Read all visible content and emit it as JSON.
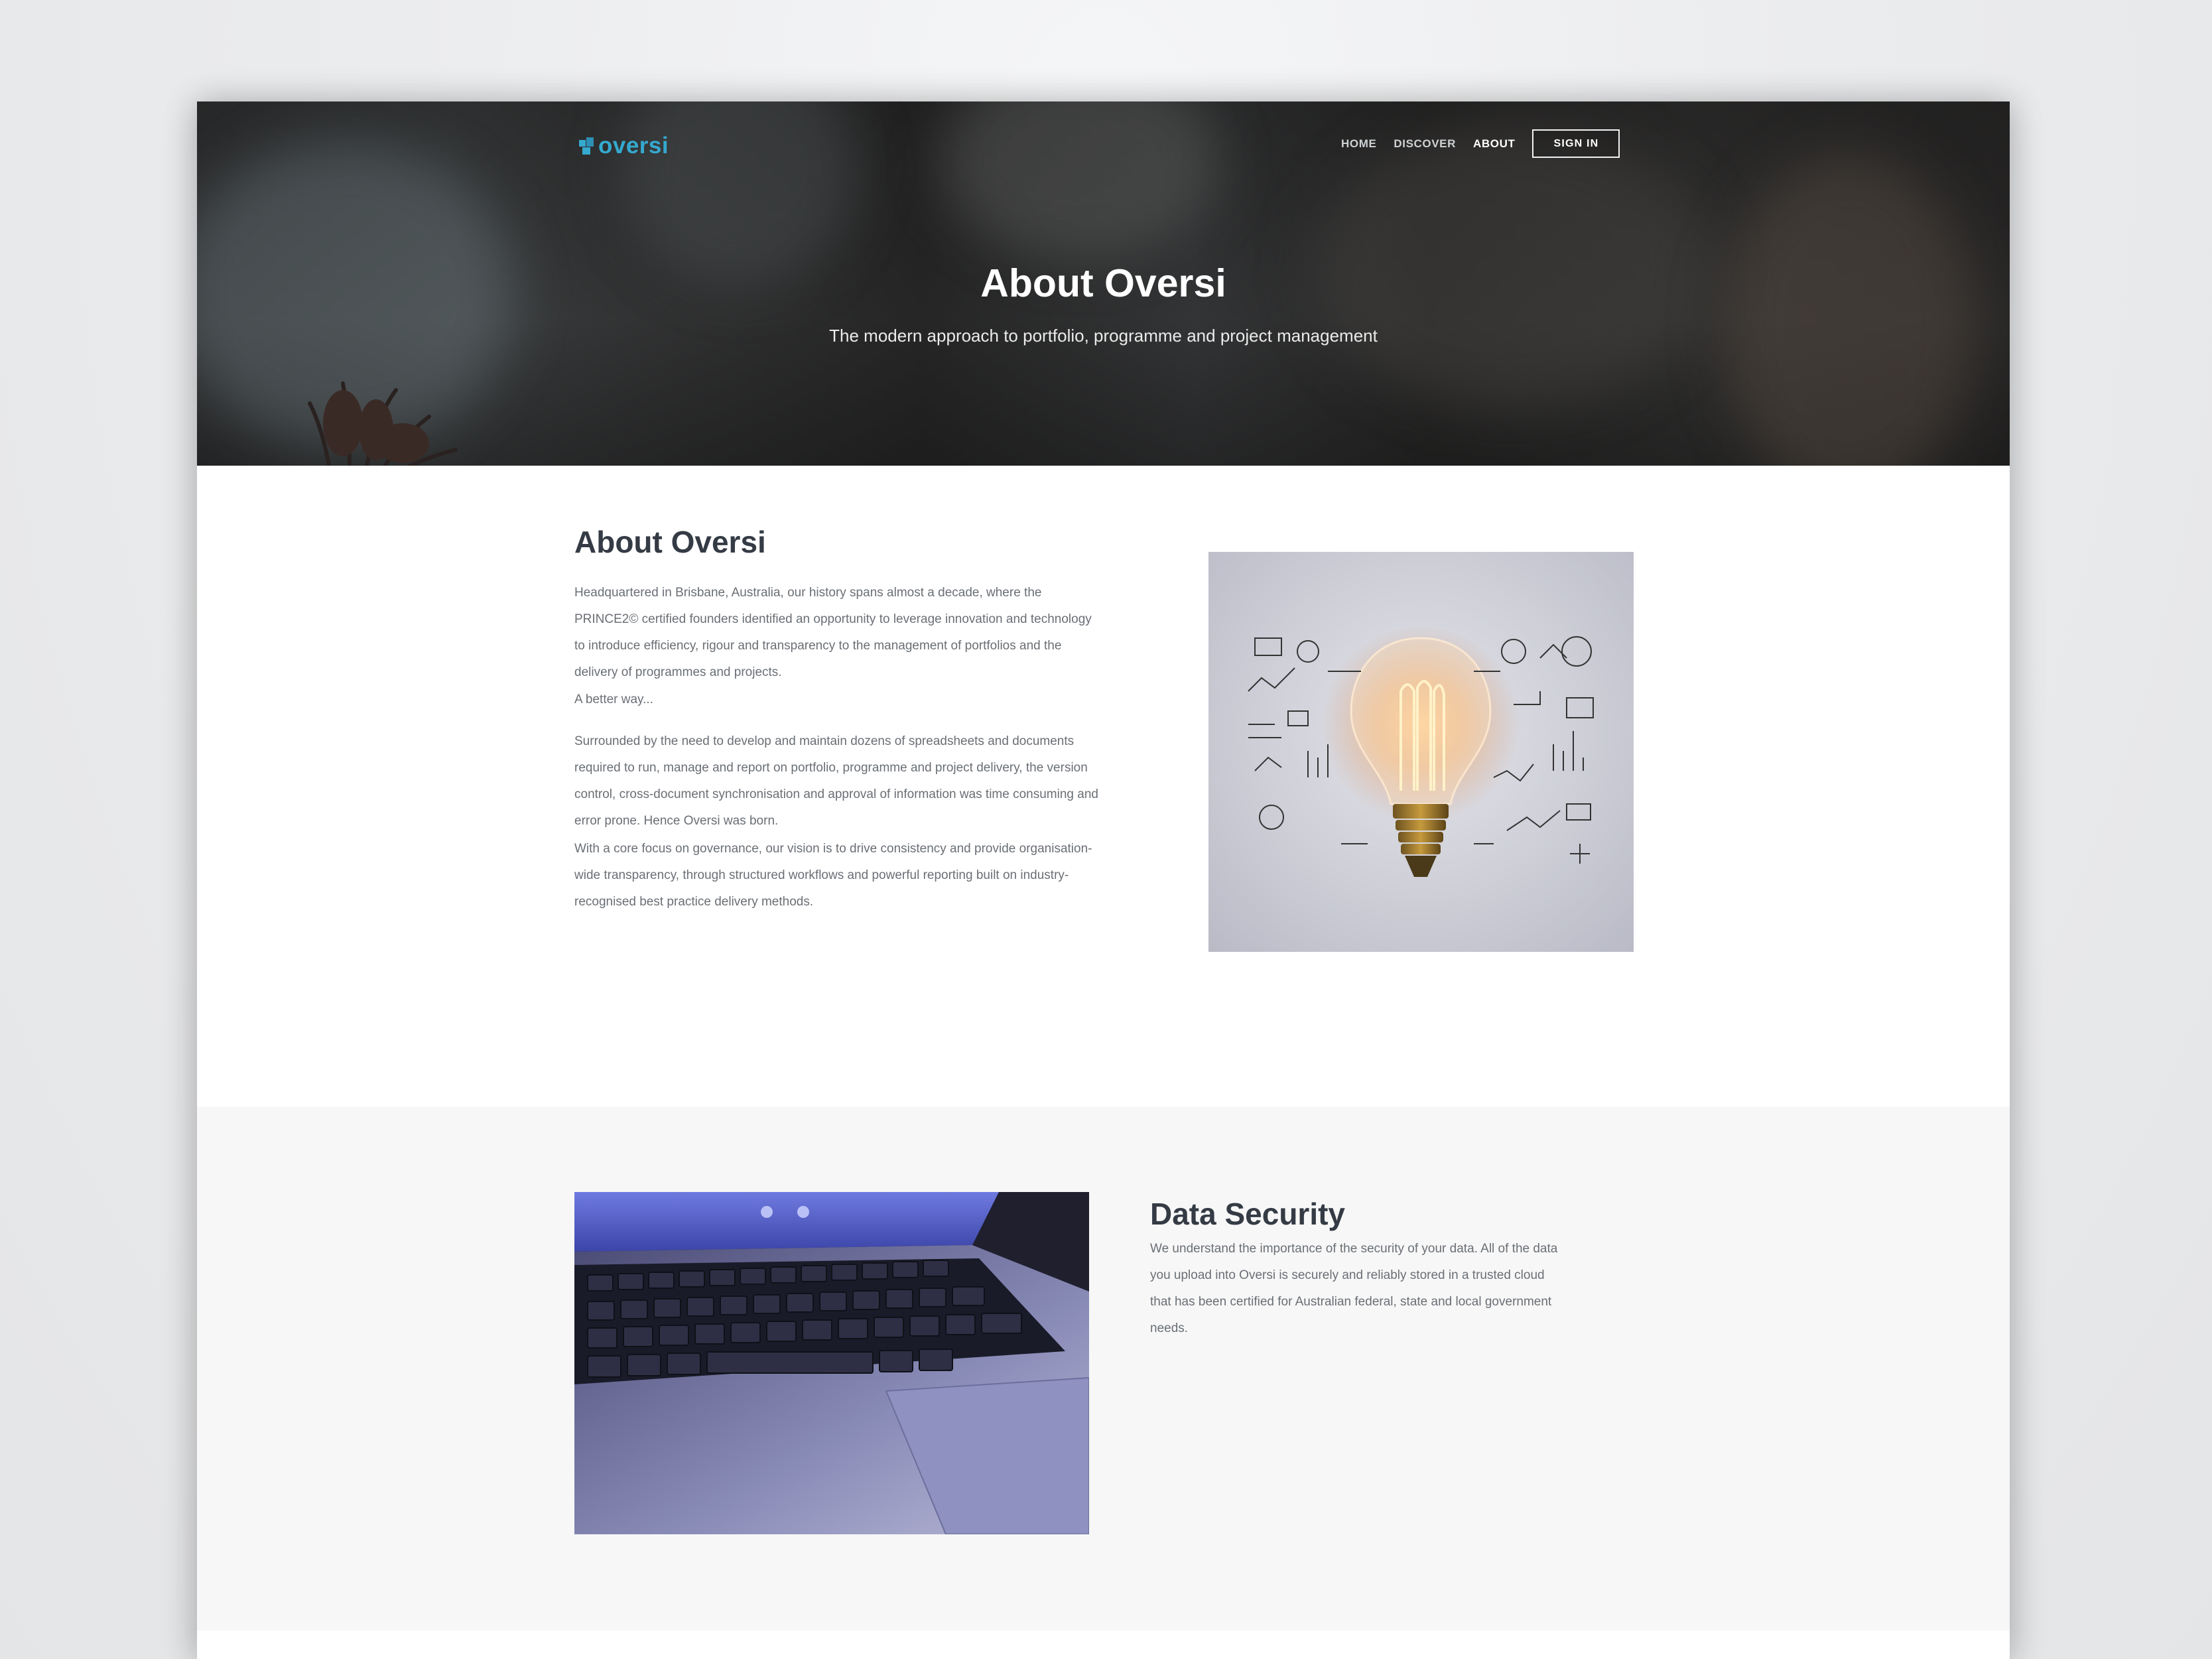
{
  "brand": {
    "name": "oversi",
    "accent_color": "#35a9cf"
  },
  "nav": {
    "items": [
      {
        "label": "HOME"
      },
      {
        "label": "DISCOVER"
      },
      {
        "label": "ABOUT",
        "active": true
      }
    ],
    "sign_in_label": "SIGN IN"
  },
  "hero": {
    "title": "About Oversi",
    "subtitle": "The modern approach to portfolio, programme and project management"
  },
  "about": {
    "heading": "About Oversi",
    "paragraphs": [
      "Headquartered in Brisbane, Australia, our history spans almost a decade, where the PRINCE2© certified founders identified an opportunity to leverage innovation and technology to introduce efficiency, rigour and transparency to the management of portfolios and the delivery of programmes and projects.",
      "A better way...",
      "Surrounded by the need to develop and maintain dozens of spreadsheets and documents required to run, manage and report on portfolio, programme and project delivery, the version control, cross-document synchronisation and approval of information was time consuming and error prone. Hence Oversi was born.",
      "With a core focus on governance, our vision is to drive consistency and provide organisation-wide transparency, through structured workflows and powerful reporting built on industry-recognised best practice delivery methods."
    ],
    "image": "lightbulb-with-sketches"
  },
  "security": {
    "heading": "Data Security",
    "paragraph": "We understand the importance of the security of your data. All of the data you upload into Oversi is securely and reliably stored in a trusted cloud that has been certified for Australian federal, state and local government needs.",
    "image": "laptop-keyboard"
  }
}
